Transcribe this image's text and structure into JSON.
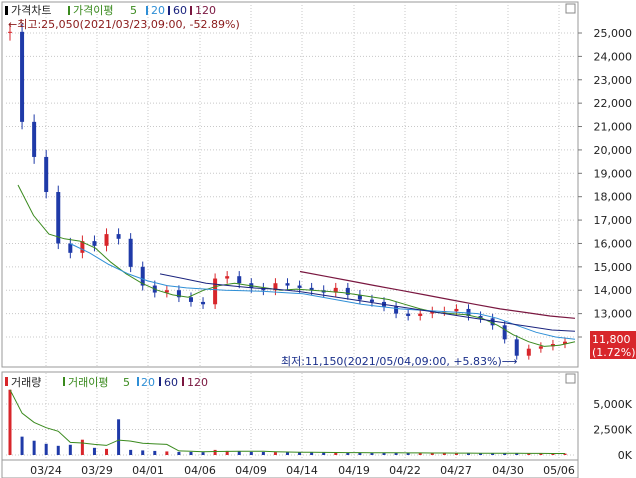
{
  "price_panel": {
    "legend": {
      "main_label": "가격차트",
      "ma_label": "가격이평",
      "ma_periods": [
        "5",
        "20",
        "60",
        "120"
      ]
    },
    "high_annotation": "←최고:25,050(2021/03/23,09:00, -52.89%)",
    "low_annotation": "최저:11,150(2021/05/04,09:00, +5.83%)⟶",
    "current_price": "11,800",
    "current_change": "(1.72%)",
    "y_ticks": [
      "25,000",
      "24,000",
      "23,000",
      "22,000",
      "21,000",
      "20,000",
      "19,000",
      "18,000",
      "17,000",
      "16,000",
      "15,000",
      "14,000",
      "13,000",
      "12,000"
    ]
  },
  "volume_panel": {
    "legend": {
      "main_label": "거래량",
      "ma_label": "거래이평",
      "ma_periods": [
        "5",
        "20",
        "60",
        "120"
      ]
    },
    "y_ticks": [
      "5,000K",
      "2,500K",
      "0K"
    ]
  },
  "x_ticks": [
    "03/24",
    "03/29",
    "04/01",
    "04/06",
    "04/09",
    "04/14",
    "04/19",
    "04/22",
    "04/27",
    "04/30",
    "05/06"
  ],
  "colors": {
    "up": "#d8262b",
    "down": "#1f3aa8",
    "ma5": "#3a8a1e",
    "ma20": "#2f8fd6",
    "ma60": "#1a237e",
    "ma120": "#7a1740",
    "grid": "#c8c8c8"
  },
  "chart_data": [
    {
      "type": "line",
      "title": "가격차트",
      "ylim": [
        11000,
        25500
      ],
      "x_tick_labels": [
        "03/24",
        "03/29",
        "04/01",
        "04/06",
        "04/09",
        "04/14",
        "04/19",
        "04/22",
        "04/27",
        "04/30",
        "05/06"
      ],
      "series": [
        {
          "name": "가격차트",
          "values": [
            25050,
            21200,
            19700,
            18200,
            16000,
            15600,
            16100,
            15900,
            16400,
            16200,
            15000,
            14200,
            13900,
            14000,
            13700,
            13500,
            13400,
            14500,
            14600,
            14300,
            14100,
            14000,
            14300,
            14200,
            14100,
            14000,
            13900,
            14100,
            13800,
            13600,
            13500,
            13300,
            13000,
            12900,
            13000,
            13100,
            13100,
            13200,
            12900,
            12800,
            12500,
            11900,
            11200,
            11500,
            11600,
            11700,
            11800
          ]
        },
        {
          "name": "5",
          "values": [
            18500,
            17200,
            16400,
            16200,
            16100,
            15800,
            15200,
            14700,
            14300,
            14000,
            13800,
            13700,
            14000,
            14200,
            14300,
            14200,
            14100,
            14000,
            14050,
            14000,
            13950,
            13900,
            13800,
            13700,
            13600,
            13400,
            13200,
            13050,
            13000,
            12950,
            12800,
            12500,
            12100,
            11800,
            11600,
            11650,
            11800
          ]
        },
        {
          "name": "20",
          "values": [
            16000,
            15600,
            15100,
            14700,
            14400,
            14200,
            14100,
            14050,
            14000,
            13980,
            13950,
            13900,
            13850,
            13700,
            13550,
            13400,
            13300,
            13200,
            13150,
            13100,
            13050,
            13000,
            12800,
            12500,
            12200,
            12000,
            11900
          ]
        },
        {
          "name": "60",
          "values": [
            14700,
            14500,
            14300,
            14200,
            14100,
            14050,
            13950,
            13800,
            13650,
            13500,
            13350,
            13200,
            13050,
            12900,
            12750,
            12600,
            12450,
            12300,
            12250
          ]
        },
        {
          "name": "120",
          "values": [
            14800,
            14600,
            14400,
            14200,
            14000,
            13800,
            13600,
            13400,
            13200,
            13050,
            12900,
            12800
          ]
        }
      ]
    },
    {
      "type": "bar",
      "title": "거래량",
      "ylabel": "",
      "ylim": [
        0,
        6500
      ],
      "series": [
        {
          "name": "거래량",
          "values": [
            6400,
            1800,
            1400,
            1100,
            900,
            1000,
            1500,
            700,
            600,
            3500,
            500,
            450,
            400,
            350,
            300,
            300,
            280,
            500,
            400,
            350,
            300,
            300,
            280,
            260,
            250,
            250,
            240,
            230,
            220,
            220,
            210,
            210,
            200,
            200,
            190,
            190,
            180,
            180,
            170,
            170,
            160,
            160,
            150,
            150,
            150,
            140,
            140
          ]
        }
      ]
    }
  ]
}
